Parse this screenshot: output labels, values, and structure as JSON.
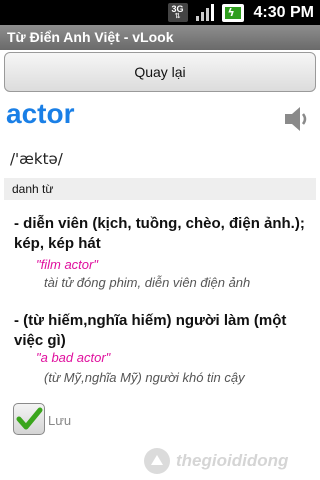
{
  "status_bar": {
    "network": "3G",
    "time": "4:30 PM"
  },
  "app": {
    "title": "Từ Điển Anh Việt - vLook"
  },
  "toolbar": {
    "back_label": "Quay lại"
  },
  "entry": {
    "word": "actor",
    "phonetic": "/'æktə/",
    "part_of_speech": "danh từ",
    "senses": [
      {
        "meaning": "- diễn viên (kịch, tuồng, chèo, điện ảnh.); kép, kép hát",
        "example_en": "\"film actor\"",
        "example_vi": "tài tử đóng phim, diễn viên điện ảnh"
      },
      {
        "meaning": "- (từ hiếm,nghĩa hiếm) người làm (một việc gì)",
        "example_en": "\"a bad actor\"",
        "example_vi": "(từ Mỹ,nghĩa Mỹ) người khó tin cậy"
      }
    ]
  },
  "save": {
    "label": "Lưu",
    "checked": true
  },
  "watermark": {
    "text": "thegioididong"
  },
  "colors": {
    "headword": "#1a7fe6",
    "example_en": "#e0109e",
    "checkmark": "#3aa51c"
  },
  "icons": [
    "3g-icon",
    "signal-icon",
    "battery-charging-icon",
    "speaker-icon",
    "checkmark-icon",
    "watermark-logo-icon"
  ]
}
